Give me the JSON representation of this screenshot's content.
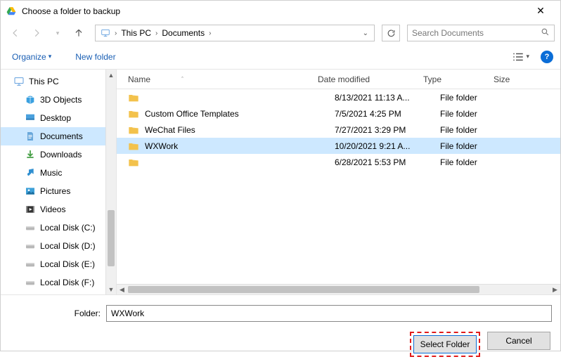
{
  "window": {
    "title": "Choose a folder to backup"
  },
  "breadcrumb": {
    "root": "This PC",
    "folder": "Documents"
  },
  "search": {
    "placeholder": "Search Documents"
  },
  "toolbar": {
    "organize": "Organize",
    "newfolder": "New folder"
  },
  "columns": {
    "name": "Name",
    "date": "Date modified",
    "type": "Type",
    "size": "Size"
  },
  "rows": [
    {
      "name": "",
      "date": "8/13/2021 11:13 A...",
      "type": "File folder",
      "selected": false
    },
    {
      "name": "Custom Office Templates",
      "date": "7/5/2021 4:25 PM",
      "type": "File folder",
      "selected": false
    },
    {
      "name": "WeChat Files",
      "date": "7/27/2021 3:29 PM",
      "type": "File folder",
      "selected": false
    },
    {
      "name": "WXWork",
      "date": "10/20/2021 9:21 A...",
      "type": "File folder",
      "selected": true
    },
    {
      "name": "",
      "date": "6/28/2021 5:53 PM",
      "type": "File folder",
      "selected": false
    }
  ],
  "tree": [
    {
      "label": "This PC",
      "icon": "pc",
      "depth": 0,
      "selected": false
    },
    {
      "label": "3D Objects",
      "icon": "3d",
      "depth": 1,
      "selected": false
    },
    {
      "label": "Desktop",
      "icon": "desktop",
      "depth": 1,
      "selected": false
    },
    {
      "label": "Documents",
      "icon": "docs",
      "depth": 1,
      "selected": true
    },
    {
      "label": "Downloads",
      "icon": "down",
      "depth": 1,
      "selected": false
    },
    {
      "label": "Music",
      "icon": "music",
      "depth": 1,
      "selected": false
    },
    {
      "label": "Pictures",
      "icon": "pics",
      "depth": 1,
      "selected": false
    },
    {
      "label": "Videos",
      "icon": "video",
      "depth": 1,
      "selected": false
    },
    {
      "label": "Local Disk (C:)",
      "icon": "drive",
      "depth": 1,
      "selected": false
    },
    {
      "label": "Local Disk (D:)",
      "icon": "drive",
      "depth": 1,
      "selected": false
    },
    {
      "label": "Local Disk (E:)",
      "icon": "drive",
      "depth": 1,
      "selected": false
    },
    {
      "label": "Local Disk (F:)",
      "icon": "drive",
      "depth": 1,
      "selected": false
    }
  ],
  "footer": {
    "label": "Folder:",
    "value": "WXWork",
    "select": "Select Folder",
    "cancel": "Cancel"
  }
}
